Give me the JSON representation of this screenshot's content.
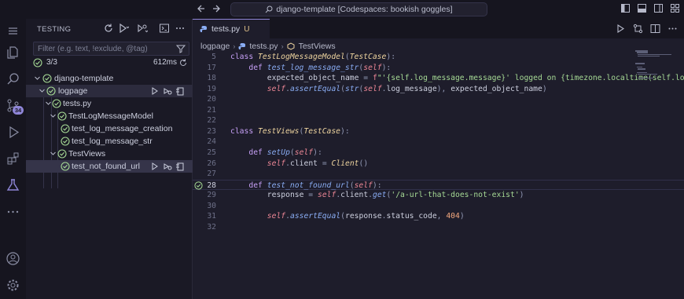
{
  "titlebar": {
    "search_text": "django-template [Codespaces: bookish goggles]"
  },
  "sidebar": {
    "title": "TESTING",
    "filter_placeholder": "Filter (e.g. text, !exclude, @tag)",
    "summary": {
      "count": "3/3",
      "time": "612ms"
    },
    "tree": [
      {
        "label": "django-template",
        "level": 0
      },
      {
        "label": "logpage",
        "level": 1
      },
      {
        "label": "tests.py",
        "level": 2
      },
      {
        "label": "TestLogMessageModel",
        "level": 3
      },
      {
        "label": "test_log_message_creation",
        "level": 4
      },
      {
        "label": "test_log_message_str",
        "level": 4
      },
      {
        "label": "TestViews",
        "level": 3
      },
      {
        "label": "test_not_found_url",
        "level": 4
      }
    ]
  },
  "activitybar": {
    "badge": "34",
    "icons": [
      "menu-icon",
      "files-icon",
      "search-icon",
      "source-control-icon",
      "run-debug-icon",
      "extensions-icon",
      "testing-icon",
      "more-icon",
      "account-icon",
      "settings-icon"
    ]
  },
  "editor": {
    "tab": {
      "name": "tests.py",
      "status": "U"
    },
    "breadcrumb": [
      "logpage",
      "tests.py",
      "TestViews"
    ],
    "current_line": "28",
    "lines": [
      {
        "n": "5",
        "text": "class TestLogMessageModel(TestCase):"
      },
      {
        "n": "17",
        "text": "def test_log_message_str(self):"
      },
      {
        "n": "18",
        "text": "expected_object_name = f\"'{self.log_message.message}' logged on {timezone.localtime(self.log_mes"
      },
      {
        "n": "19",
        "text": "self.assertEqual(str(self.log_message), expected_object_name)"
      },
      {
        "n": "20",
        "text": ""
      },
      {
        "n": "21",
        "text": ""
      },
      {
        "n": "22",
        "text": ""
      },
      {
        "n": "23",
        "text": "class TestViews(TestCase):"
      },
      {
        "n": "24",
        "text": ""
      },
      {
        "n": "25",
        "text": "def setUp(self):"
      },
      {
        "n": "26",
        "text": "self.client = Client()"
      },
      {
        "n": "27",
        "text": ""
      },
      {
        "n": "28",
        "text": "def test_not_found_url(self):"
      },
      {
        "n": "29",
        "text": "response = self.client.get('/a-url-that-does-not-exist')"
      },
      {
        "n": "30",
        "text": ""
      },
      {
        "n": "31",
        "text": "self.assertEqual(response.status_code, 404)"
      },
      {
        "n": "32",
        "text": ""
      }
    ]
  },
  "colors": {
    "accent": "#8f86d8",
    "pass": "#a6da95",
    "background": "#1e1d2b"
  }
}
